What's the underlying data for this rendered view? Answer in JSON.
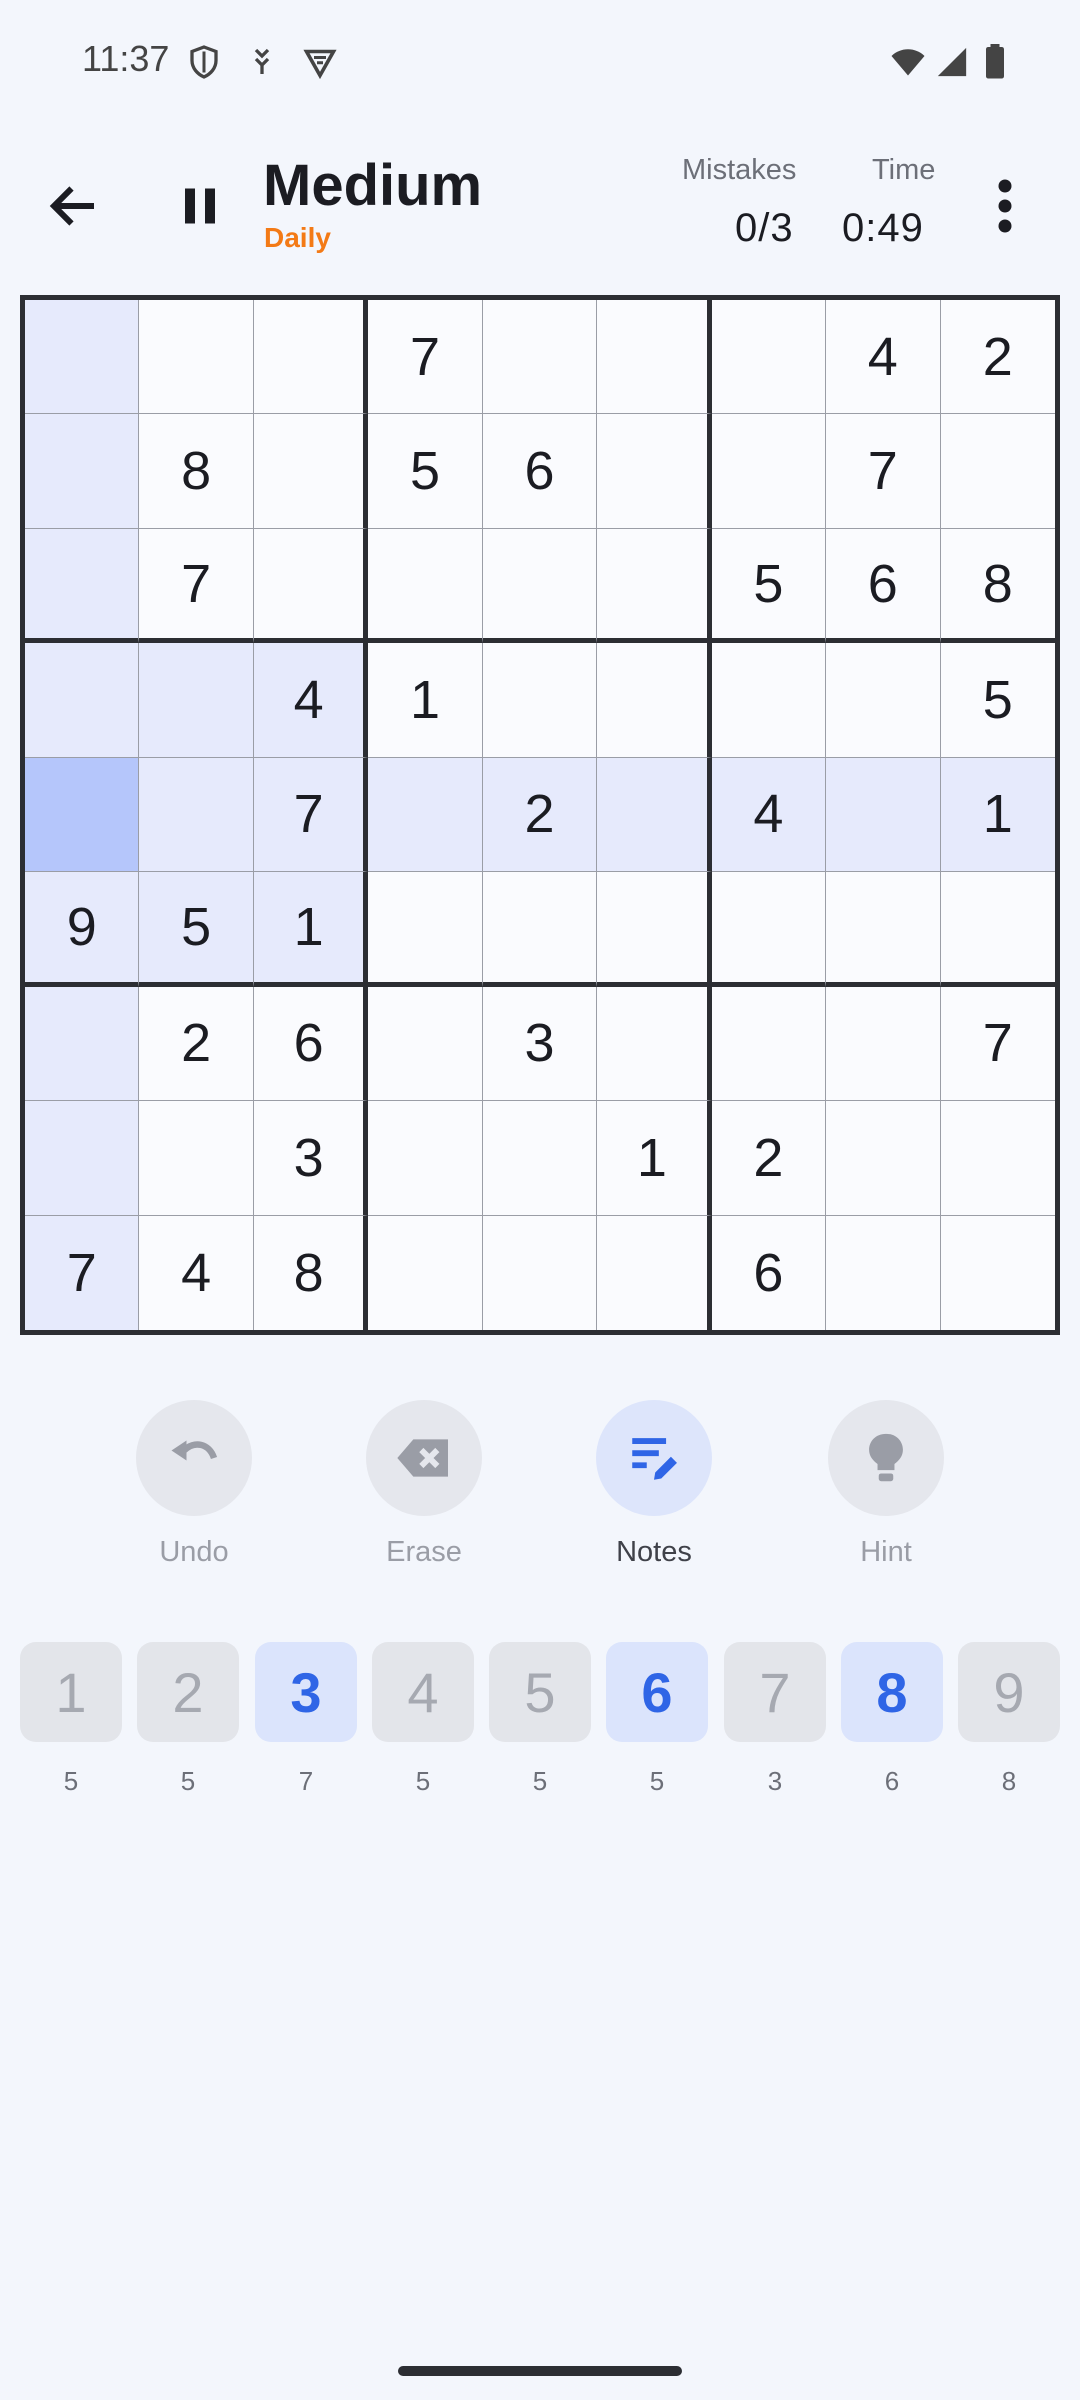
{
  "status_bar": {
    "time": "11:37"
  },
  "header": {
    "title": "Medium",
    "subtitle": "Daily",
    "mistakes_label": "Mistakes",
    "mistakes_value": "0/3",
    "time_label": "Time",
    "time_value": "0:49"
  },
  "board": {
    "grid": [
      [
        "",
        "",
        "",
        "7",
        "",
        "",
        "",
        "4",
        "2"
      ],
      [
        "",
        "8",
        "",
        "5",
        "6",
        "",
        "",
        "7",
        ""
      ],
      [
        "",
        "7",
        "",
        "",
        "",
        "",
        "5",
        "6",
        "8"
      ],
      [
        "",
        "",
        "4",
        "1",
        "",
        "",
        "",
        "",
        "5"
      ],
      [
        "",
        "",
        "7",
        "",
        "2",
        "",
        "4",
        "",
        "1"
      ],
      [
        "9",
        "5",
        "1",
        "",
        "",
        "",
        "",
        "",
        ""
      ],
      [
        "",
        "2",
        "6",
        "",
        "3",
        "",
        "",
        "",
        "7"
      ],
      [
        "",
        "",
        "3",
        "",
        "",
        "1",
        "2",
        "",
        ""
      ],
      [
        "7",
        "4",
        "8",
        "",
        "",
        "",
        "6",
        "",
        ""
      ]
    ],
    "selected": {
      "row": 4,
      "col": 0
    }
  },
  "tools": [
    {
      "label": "Undo",
      "icon": "undo-icon",
      "active": false
    },
    {
      "label": "Erase",
      "icon": "erase-icon",
      "active": false
    },
    {
      "label": "Notes",
      "icon": "notes-pencil-icon",
      "active": true
    },
    {
      "label": "Hint",
      "icon": "lightbulb-icon",
      "active": false
    }
  ],
  "numpad": [
    {
      "digit": "1",
      "count": "5",
      "active": false
    },
    {
      "digit": "2",
      "count": "5",
      "active": false
    },
    {
      "digit": "3",
      "count": "7",
      "active": true
    },
    {
      "digit": "4",
      "count": "5",
      "active": false
    },
    {
      "digit": "5",
      "count": "5",
      "active": false
    },
    {
      "digit": "6",
      "count": "5",
      "active": true
    },
    {
      "digit": "7",
      "count": "3",
      "active": false
    },
    {
      "digit": "8",
      "count": "6",
      "active": true
    },
    {
      "digit": "9",
      "count": "8",
      "active": false
    }
  ],
  "colors": {
    "accent": "#2f65e6",
    "subtitle": "#f37a16",
    "selected_cell": "#b5c6fb",
    "highlight_cell": "#e6eafc"
  }
}
